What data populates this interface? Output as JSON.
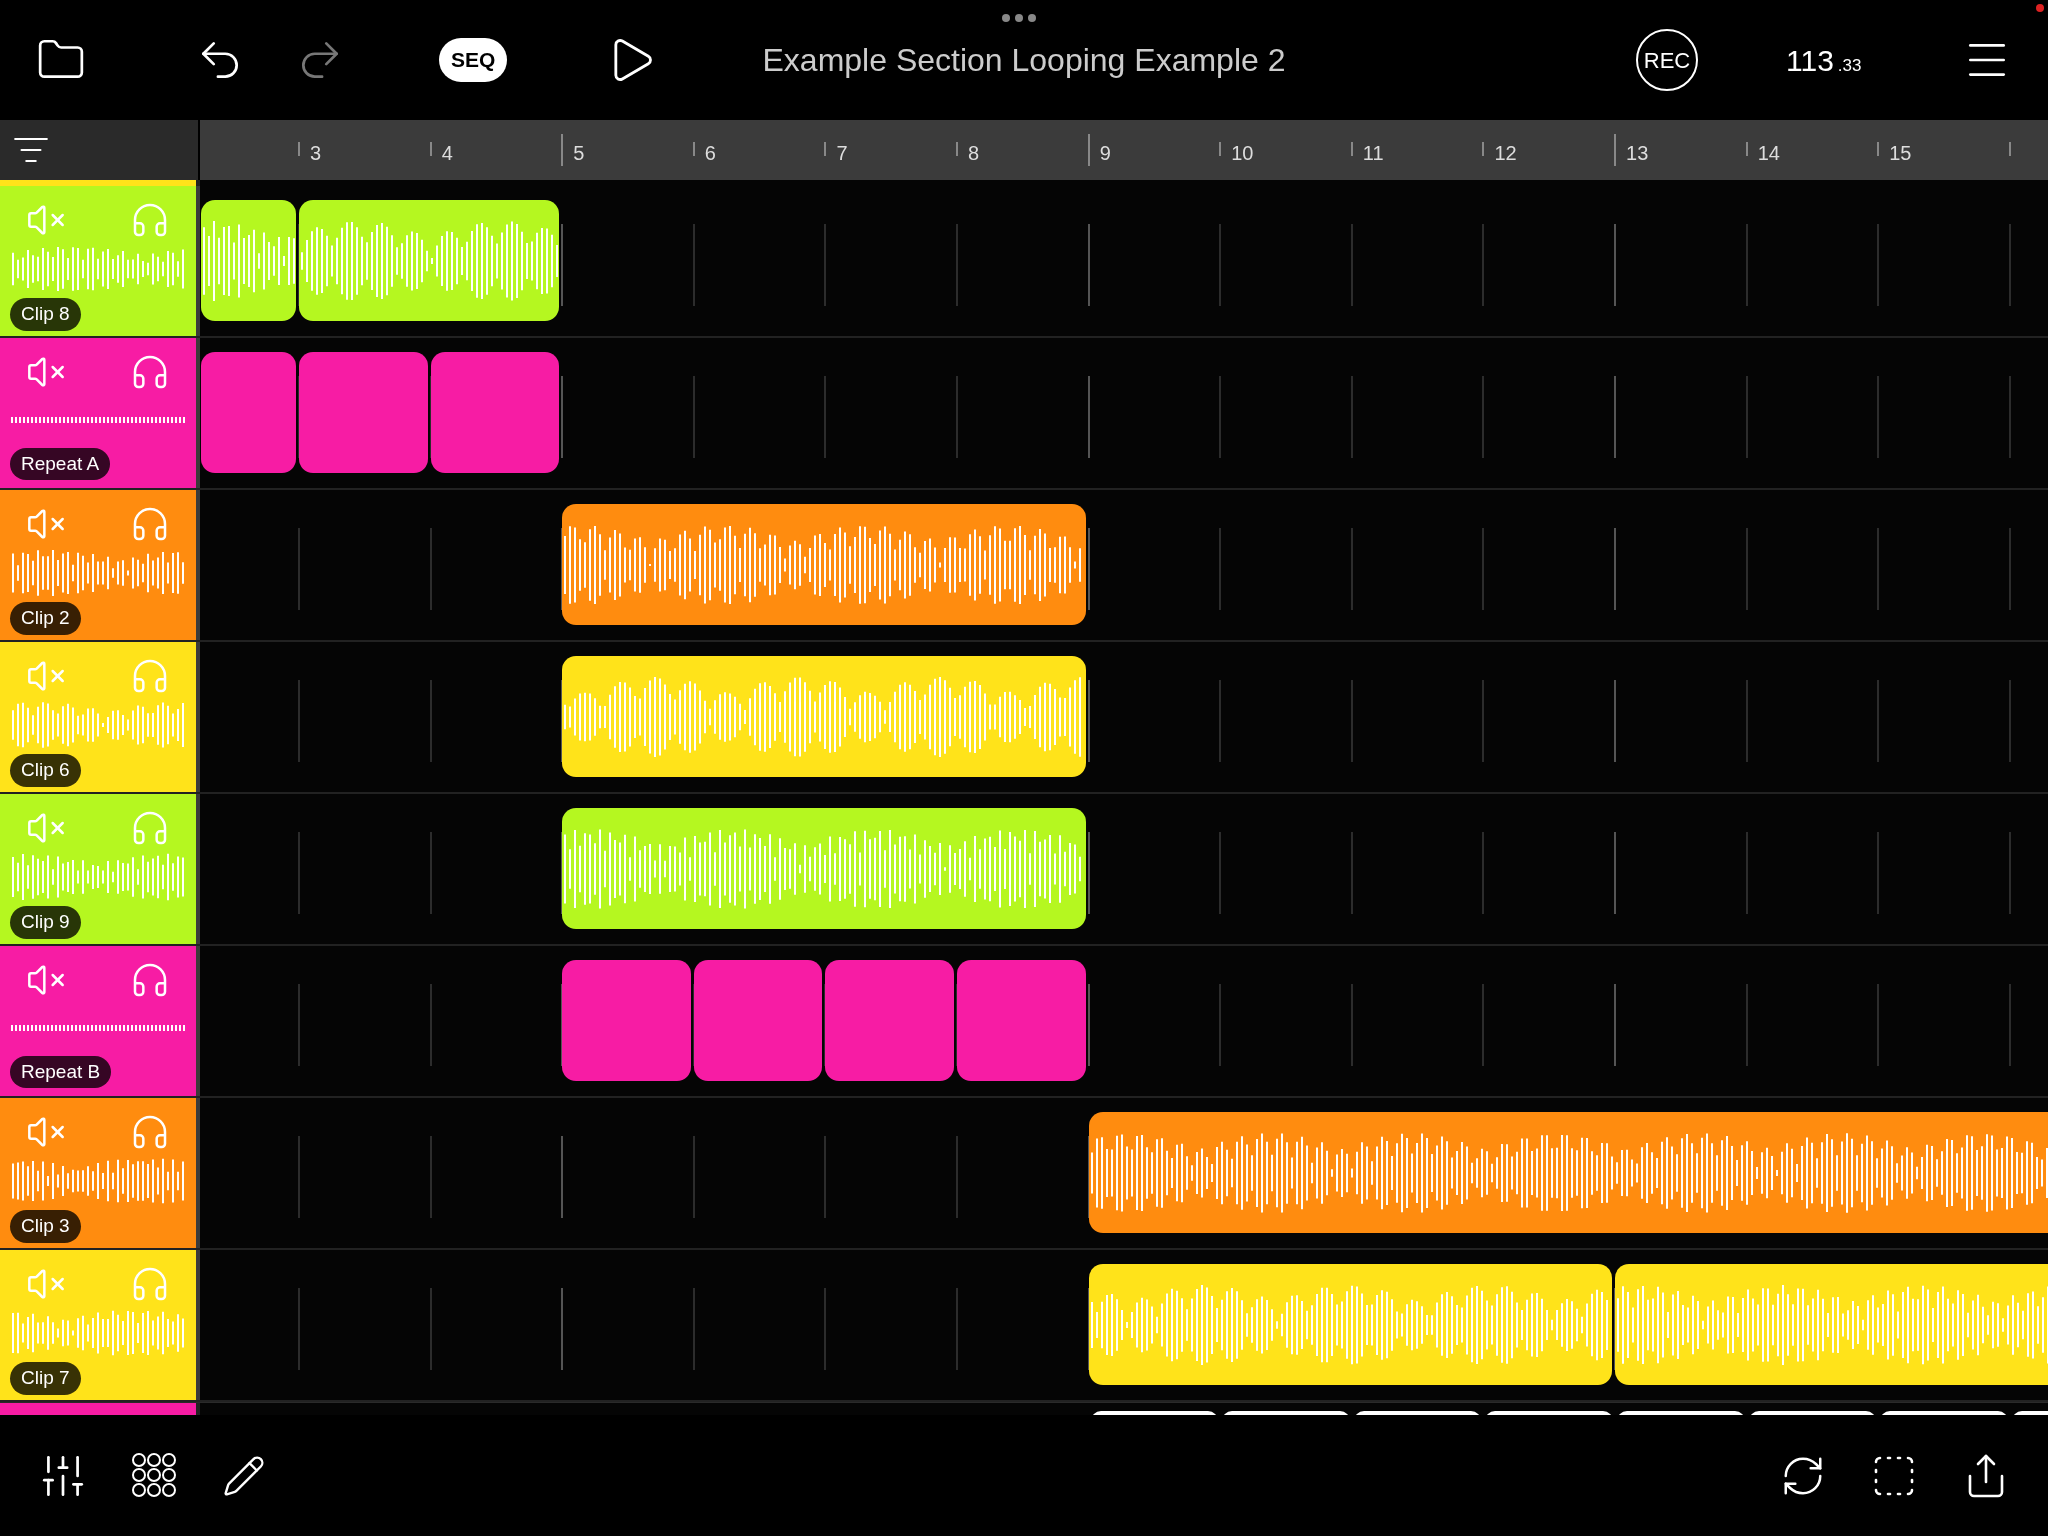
{
  "top_bar": {
    "seq": "SEQ",
    "title": "Example Section Looping Example 2",
    "rec": "REC",
    "tempo": "113",
    "tempo_fraction": ".33"
  },
  "ruler": {
    "bars": [
      "3",
      "4",
      "5",
      "6",
      "7",
      "8",
      "9",
      "10",
      "11",
      "12",
      "13",
      "14",
      "15"
    ]
  },
  "tracks": [
    {
      "kind": "cut",
      "color": "#ffe31a"
    },
    {
      "kind": "audio",
      "name": "Clip 8",
      "color": "#b5f720"
    },
    {
      "kind": "repeat",
      "name": "Repeat A",
      "color": "#f71ca4"
    },
    {
      "kind": "audio",
      "name": "Clip 2",
      "color": "#ff8c0f"
    },
    {
      "kind": "audio",
      "name": "Clip 6",
      "color": "#ffe31a"
    },
    {
      "kind": "audio",
      "name": "Clip 9",
      "color": "#b5f720"
    },
    {
      "kind": "repeat",
      "name": "Repeat B",
      "color": "#f71ca4"
    },
    {
      "kind": "audio",
      "name": "Clip 3",
      "color": "#ff8c0f"
    },
    {
      "kind": "audio",
      "name": "Clip 7",
      "color": "#ffe31a"
    },
    {
      "kind": "cut",
      "color": "#f71ca4"
    }
  ]
}
